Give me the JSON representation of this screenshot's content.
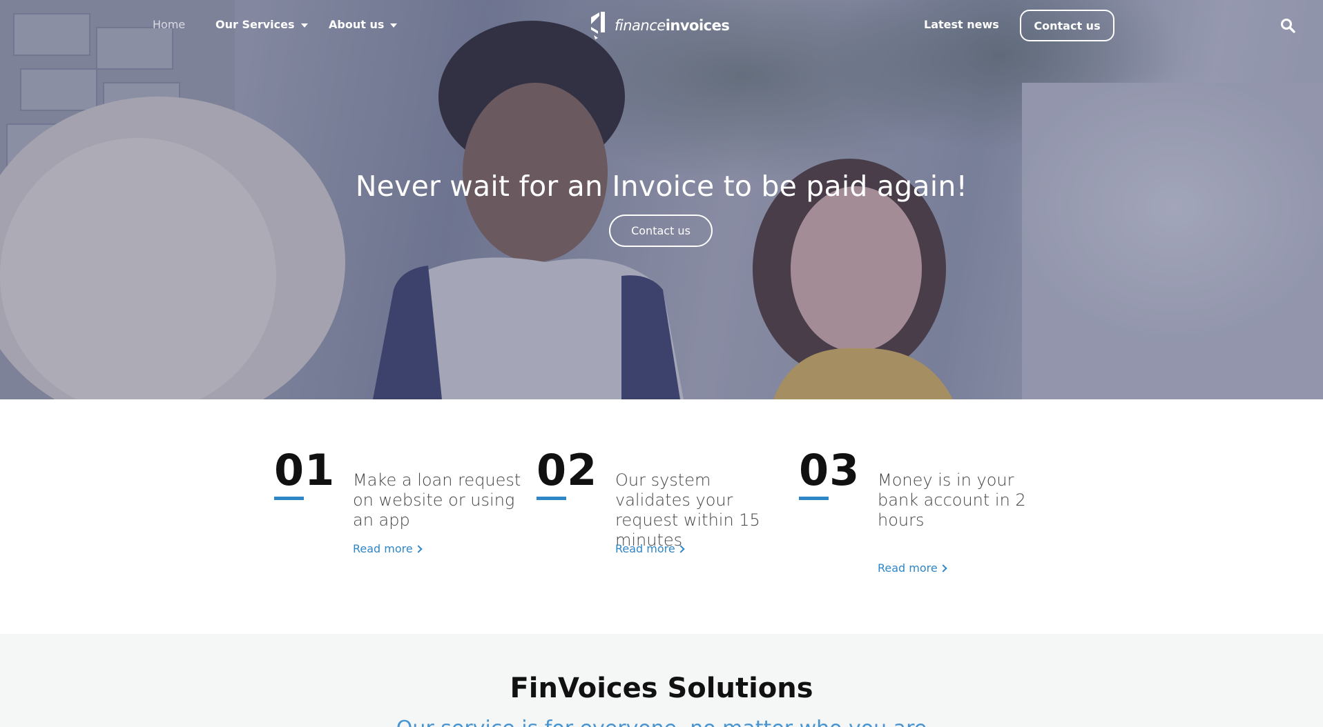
{
  "nav": {
    "home": "Home",
    "services": "Our Services",
    "about": "About us",
    "latest_news": "Latest news",
    "contact": "Contact us"
  },
  "logo": {
    "light": "finance",
    "bold": "invoices"
  },
  "hero": {
    "title": "Never wait for an Invoice to be paid again!",
    "cta": "Contact us"
  },
  "steps": [
    {
      "number": "01",
      "text": "Make a loan request on website or using an app",
      "link": "Read more"
    },
    {
      "number": "02",
      "text": "Our system validates your request within 15 minutes",
      "link": "Read more"
    },
    {
      "number": "03",
      "text": "Money is in your bank account in 2 hours",
      "link": "Read more"
    }
  ],
  "solutions": {
    "title": "FinVoices Solutions",
    "subtitle": "Our service is for everyone, no matter who you are"
  },
  "colors": {
    "accent": "#2f86c6",
    "hero_overlay": "#464a78",
    "solutions_bg": "#f5f6f6"
  },
  "icons": [
    "search-icon",
    "caret-down-icon",
    "chevron-right-icon",
    "logo-mark-icon"
  ]
}
